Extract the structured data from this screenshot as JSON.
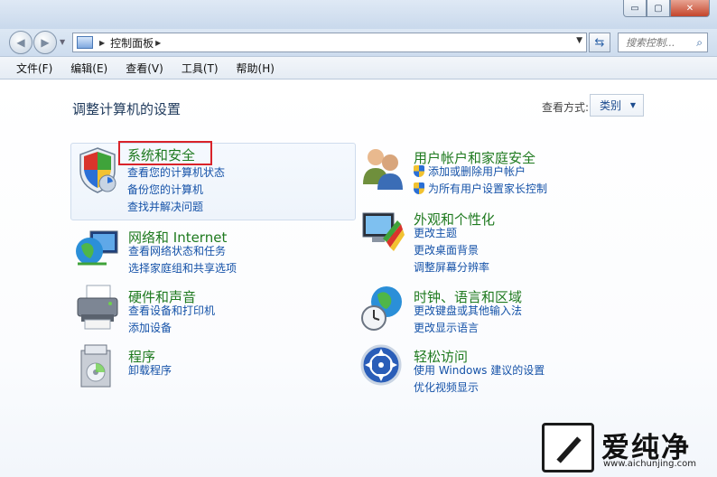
{
  "window": {
    "minimize_glyph": "▭",
    "maximize_glyph": "▢",
    "close_glyph": "✕"
  },
  "address": {
    "breadcrumb": "控制面板",
    "search_placeholder": "搜索控制..."
  },
  "menu": [
    "文件(F)",
    "编辑(E)",
    "查看(V)",
    "工具(T)",
    "帮助(H)"
  ],
  "page_title": "调整计算机的设置",
  "view_by": {
    "label": "查看方式:",
    "value": "类别"
  },
  "categories": {
    "system_security": {
      "title": "系统和安全",
      "links": [
        "查看您的计算机状态",
        "备份您的计算机",
        "查找并解决问题"
      ],
      "icon": "shield-icon"
    },
    "user_accounts": {
      "title": "用户帐户和家庭安全",
      "links": [
        "添加或删除用户帐户",
        "为所有用户设置家长控制"
      ],
      "icon": "users-icon"
    },
    "network": {
      "title": "网络和 Internet",
      "links": [
        "查看网络状态和任务",
        "选择家庭组和共享选项"
      ],
      "icon": "network-globe-icon"
    },
    "appearance": {
      "title": "外观和个性化",
      "links": [
        "更改主题",
        "更改桌面背景",
        "调整屏幕分辨率"
      ],
      "icon": "monitor-palette-icon"
    },
    "hardware": {
      "title": "硬件和声音",
      "links": [
        "查看设备和打印机",
        "添加设备"
      ],
      "icon": "printer-icon"
    },
    "clock": {
      "title": "时钟、语言和区域",
      "links": [
        "更改键盘或其他输入法",
        "更改显示语言"
      ],
      "icon": "globe-clock-icon"
    },
    "programs": {
      "title": "程序",
      "links": [
        "卸载程序"
      ],
      "icon": "programs-box-icon"
    },
    "ease": {
      "title": "轻松访问",
      "links": [
        "使用 Windows 建议的设置",
        "优化视频显示"
      ],
      "icon": "ease-of-access-icon"
    }
  },
  "watermark": {
    "text": "爱纯净",
    "url": "www.aichunjing.com"
  },
  "colors": {
    "category_title": "#1f7a1f",
    "link": "#1552a8",
    "highlight_box": "#d9232a"
  }
}
